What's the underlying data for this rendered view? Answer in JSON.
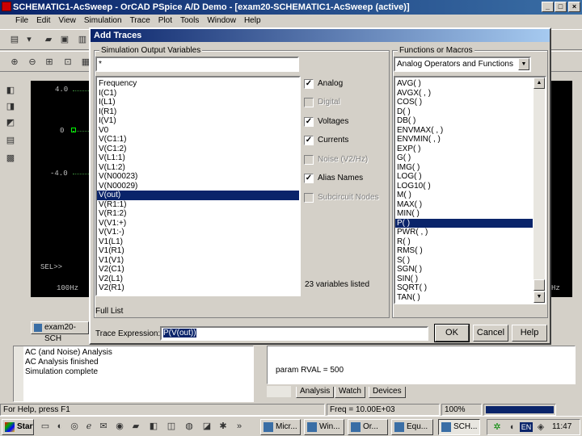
{
  "app": {
    "title": "SCHEMATIC1-AcSweep - OrCAD PSpice A/D Demo - [exam20-SCHEMATIC1-AcSweep (active)]",
    "menu": [
      "File",
      "Edit",
      "View",
      "Simulation",
      "Trace",
      "Plot",
      "Tools",
      "Window",
      "Help"
    ]
  },
  "plot": {
    "y_ticks": [
      "4.0",
      "0",
      "-4.0"
    ],
    "x_start": "100Hz",
    "x_end": "Hz",
    "sel_label": "SEL>>"
  },
  "dialog": {
    "title": "Add Traces",
    "sim_group_label": "Simulation Output Variables",
    "filter_value": "*",
    "variables": [
      "Frequency",
      "I(C1)",
      "I(L1)",
      "I(R1)",
      "I(V1)",
      "V0",
      "V(C1:1)",
      "V(C1:2)",
      "V(L1:1)",
      "V(L1:2)",
      "V(N00023)",
      "V(N00029)",
      "V(out)",
      "V(R1:1)",
      "V(R1:2)",
      "V(V1:+)",
      "V(V1:-)",
      "V1(L1)",
      "V1(R1)",
      "V1(V1)",
      "V2(C1)",
      "V2(L1)",
      "V2(R1)"
    ],
    "selected_variable": "V(out)",
    "checks": [
      {
        "label": "Analog",
        "checked": true,
        "disabled": false
      },
      {
        "label": "Digital",
        "checked": false,
        "disabled": true
      },
      {
        "label": "Voltages",
        "checked": true,
        "disabled": false
      },
      {
        "label": "Currents",
        "checked": true,
        "disabled": false
      },
      {
        "label": "Noise (V2/Hz)",
        "checked": false,
        "disabled": true
      },
      {
        "label": "Alias Names",
        "checked": true,
        "disabled": false
      },
      {
        "label": "Subcircuit Nodes",
        "checked": false,
        "disabled": true
      }
    ],
    "count_label": "23 variables listed",
    "full_list_label": "Full List",
    "functions_group_label": "Functions or Macros",
    "functions_dropdown": "Analog Operators and Functions",
    "functions": [
      "AVG( )",
      "AVGX( , )",
      "COS( )",
      "D( )",
      "DB( )",
      "ENVMAX( , )",
      "ENVMIN( , )",
      "EXP( )",
      "G( )",
      "IMG( )",
      "LOG( )",
      "LOG10( )",
      "M( )",
      "MAX( )",
      "MIN( )",
      "P( )",
      "PWR( , )",
      "R( )",
      "RMS( )",
      "S( )",
      "SGN( )",
      "SIN( )",
      "SQRT( )",
      "TAN( )"
    ],
    "selected_function": "P( )",
    "trace_expression_label": "Trace Expression:",
    "trace_expression_value": "P(V(out))",
    "ok": "OK",
    "cancel": "Cancel",
    "help": "Help"
  },
  "doc_tab": "exam20-SCH",
  "output_log": [
    "AC (and Noise) Analysis",
    "AC Analysis finished",
    "Simulation complete"
  ],
  "param_text": "param RVAL = 500",
  "bottom_tabs": [
    "Analysis",
    "Watch",
    "Devices"
  ],
  "status": {
    "help": "For Help, press F1",
    "freq": "Freq = 10.00E+03",
    "zoom": "100%"
  },
  "taskbar": {
    "start": "Start",
    "tasks": [
      "Micr...",
      "Win...",
      "Or...",
      "Equ...",
      "SCH..."
    ],
    "lang": "EN",
    "time": "11:47"
  }
}
